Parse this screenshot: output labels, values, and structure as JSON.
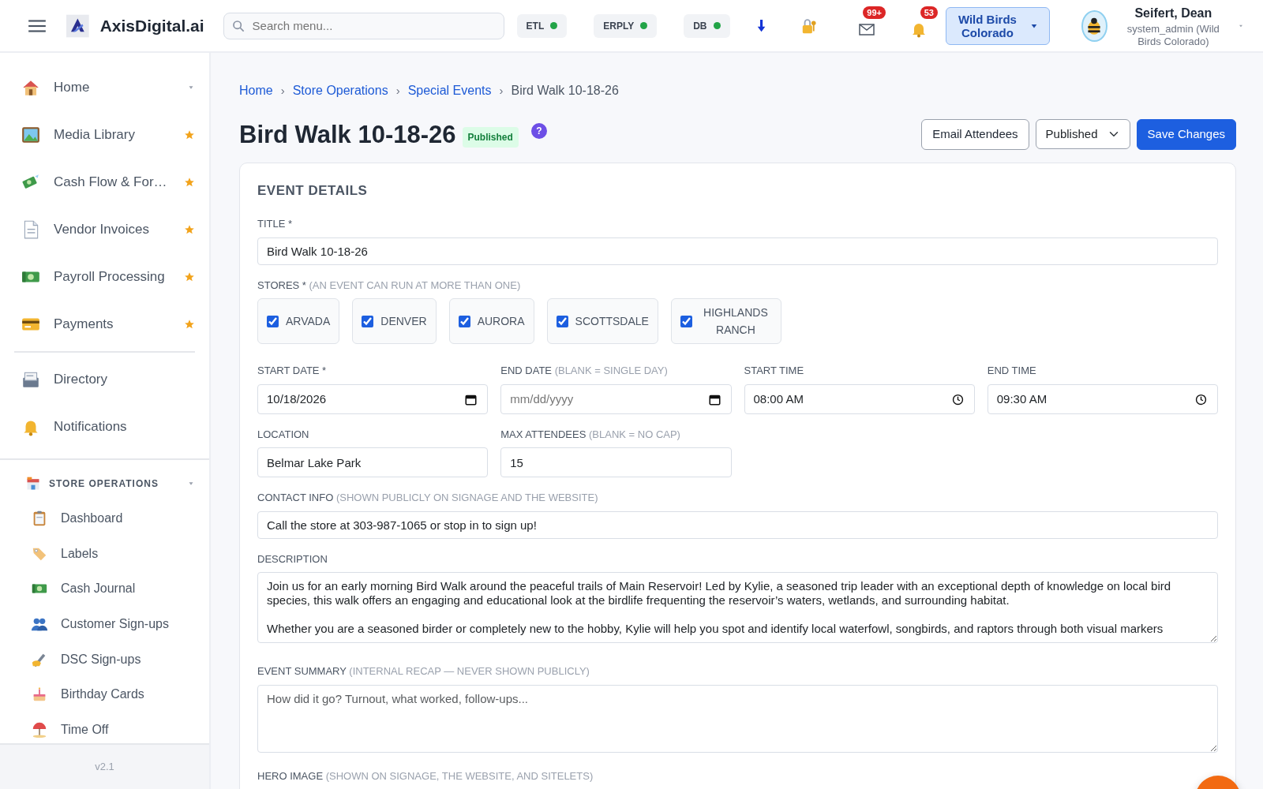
{
  "header": {
    "brand": "AxisDigital.ai",
    "search": {
      "placeholder": "Search menu..."
    },
    "statuses": [
      {
        "label": "ETL",
        "color": "#22a447"
      },
      {
        "label": "ERPLY",
        "color": "#22a447"
      },
      {
        "label": "DB",
        "color": "#22a447"
      }
    ],
    "mail_badge": "99+",
    "bell_badge": "53",
    "store_selector": "Wild Birds Colorado",
    "user": {
      "name": "Seifert, Dean",
      "role": "system_admin (Wild Birds Colorado)"
    }
  },
  "sidebar": {
    "items": [
      {
        "label": "Home",
        "kind": "submenu"
      },
      {
        "label": "Media Library",
        "kind": "favorite"
      },
      {
        "label": "Cash Flow & For…",
        "kind": "favorite"
      },
      {
        "label": "Vendor Invoices",
        "kind": "favorite"
      },
      {
        "label": "Payroll Processing",
        "kind": "favorite"
      },
      {
        "label": "Payments",
        "kind": "favorite"
      },
      {
        "label": "Directory",
        "kind": "plain"
      },
      {
        "label": "Notifications",
        "kind": "plain"
      }
    ],
    "section": {
      "label": "STORE OPERATIONS",
      "expanded": true,
      "children": [
        {
          "label": "Dashboard"
        },
        {
          "label": "Labels"
        },
        {
          "label": "Cash Journal"
        },
        {
          "label": "Customer Sign-ups"
        },
        {
          "label": "DSC Sign-ups"
        },
        {
          "label": "Birthday Cards"
        },
        {
          "label": "Time Off"
        }
      ]
    },
    "version": "v2.1"
  },
  "breadcrumbs": {
    "separator": "›",
    "items": [
      {
        "label": "Home",
        "current": false
      },
      {
        "label": "Store Operations",
        "current": false
      },
      {
        "label": "Special Events",
        "current": false
      },
      {
        "label": "Bird Walk 10-18-26",
        "current": true
      }
    ]
  },
  "page": {
    "title": "Bird Walk 10-18-26",
    "status_badge": "Published",
    "help": "?",
    "buttons": {
      "email": "Email Attendees",
      "status_select": "Published",
      "save": "Save Changes"
    }
  },
  "form": {
    "section_title": "EVENT DETAILS",
    "title": {
      "label": "TITLE *",
      "value": "Bird Walk 10-18-26"
    },
    "stores": {
      "label": "STORES *",
      "hint": "(AN EVENT CAN RUN AT MORE THAN ONE)",
      "options": [
        {
          "label": "ARVADA",
          "checked": true
        },
        {
          "label": "DENVER",
          "checked": true
        },
        {
          "label": "AURORA",
          "checked": true
        },
        {
          "label": "SCOTTSDALE",
          "checked": true
        },
        {
          "label": "HIGHLANDS RANCH",
          "checked": true
        }
      ]
    },
    "start_date": {
      "label": "START DATE *",
      "value": "10/18/2026"
    },
    "end_date": {
      "label": "END DATE",
      "hint": "(BLANK = SINGLE DAY)",
      "placeholder": "mm/dd/yyyy"
    },
    "start_time": {
      "label": "START TIME",
      "value": "08:00 AM"
    },
    "end_time": {
      "label": "END TIME",
      "value": "09:30 AM"
    },
    "location": {
      "label": "LOCATION",
      "value": "Belmar Lake Park"
    },
    "max_attendees": {
      "label": "MAX ATTENDEES",
      "hint": "(BLANK = NO CAP)",
      "value": "15"
    },
    "contact": {
      "label": "CONTACT INFO",
      "hint": "(SHOWN PUBLICLY ON SIGNAGE AND THE WEBSITE)",
      "value": "Call the store at 303-987-1065 or stop in to sign up!"
    },
    "description": {
      "label": "DESCRIPTION",
      "value": "Join us for an early morning Bird Walk around the peaceful trails of Main Reservoir! Led by Kylie, a seasoned trip leader with an exceptional depth of knowledge on local bird species, this walk offers an engaging and educational look at the birdlife frequenting the reservoir’s waters, wetlands, and surrounding habitat.\n\nWhether you are a seasoned birder or completely new to the hobby, Kylie will help you spot and identify local waterfowl, songbirds, and raptors through both visual markers"
    },
    "summary": {
      "label": "EVENT SUMMARY",
      "hint": "(INTERNAL RECAP — NEVER SHOWN PUBLICLY)",
      "placeholder": "How did it go? Turnout, what worked, follow-ups..."
    },
    "hero": {
      "label": "HERO IMAGE",
      "hint": "(SHOWN ON SIGNAGE, THE WEBSITE, AND SITELETS)"
    }
  }
}
